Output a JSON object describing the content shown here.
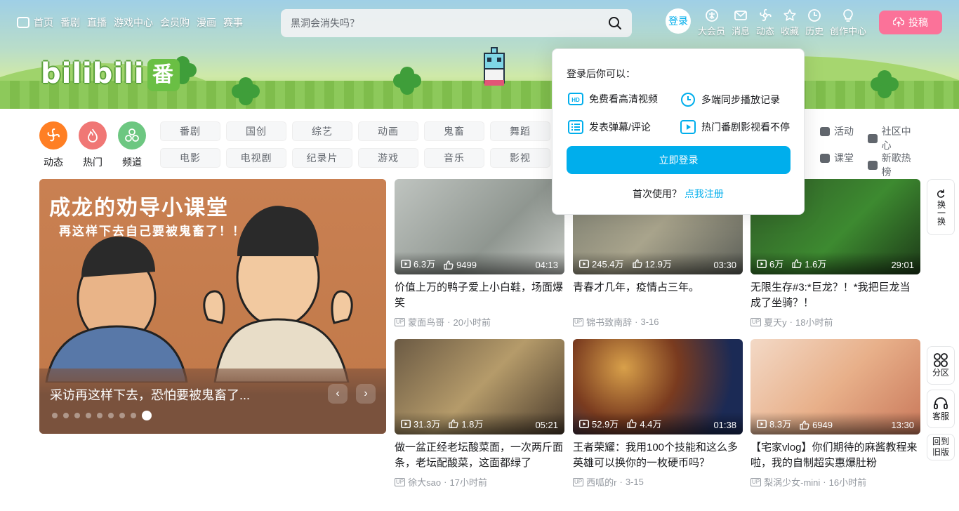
{
  "header": {
    "left_nav": [
      {
        "label": "首页",
        "icon": "tv-icon"
      },
      {
        "label": "番剧"
      },
      {
        "label": "直播"
      },
      {
        "label": "游戏中心"
      },
      {
        "label": "会员购"
      },
      {
        "label": "漫画"
      },
      {
        "label": "赛事"
      }
    ],
    "search": {
      "placeholder": "黑洞会消失吗？"
    },
    "login_label": "登录",
    "right_nav": [
      {
        "label": "大会员",
        "icon": "vip-icon"
      },
      {
        "label": "消息",
        "icon": "message-icon"
      },
      {
        "label": "动态",
        "icon": "dynamic-icon"
      },
      {
        "label": "收藏",
        "icon": "star-icon"
      },
      {
        "label": "历史",
        "icon": "clock-icon"
      },
      {
        "label": "创作中心",
        "icon": "bulb-icon"
      }
    ],
    "upload_label": "投稿"
  },
  "banner": {
    "logo_text": "bilibili",
    "logo_badge": "番"
  },
  "channels": {
    "icons": [
      {
        "label": "动态",
        "color": "#ff7f24"
      },
      {
        "label": "热门",
        "color": "#f07775"
      },
      {
        "label": "频道",
        "color": "#6dc781"
      }
    ],
    "tags": [
      "番剧",
      "国创",
      "综艺",
      "动画",
      "鬼畜",
      "舞蹈",
      "电影",
      "电视剧",
      "纪录片",
      "游戏",
      "音乐",
      "影视"
    ],
    "extras": [
      "活动",
      "社区中心",
      "课堂",
      "新歌热榜"
    ]
  },
  "carousel": {
    "art_title": "成龙的劝导小课堂",
    "art_subtitle": "再这样下去自己要被鬼畜了！！",
    "caption": "采访再这样下去，恐怕要被鬼畜了...",
    "dot_count": 9,
    "active_dot": 8
  },
  "videos": [
    {
      "views": "6.3万",
      "likes": "9499",
      "duration": "04:13",
      "title": "价值上万的鸭子爱上小白鞋，场面爆笑",
      "author": "蒙面鸟哥",
      "date": "20小时前"
    },
    {
      "views": "245.4万",
      "likes": "12.9万",
      "duration": "03:30",
      "title": "青春才几年，疫情占三年。",
      "author": "锦书致南辞",
      "date": "3-16"
    },
    {
      "views": "6万",
      "likes": "1.6万",
      "duration": "29:01",
      "title": "无限生存#3:*巨龙？！*我把巨龙当成了坐骑？！",
      "author": "夏天y",
      "date": "18小时前"
    },
    {
      "views": "31.3万",
      "likes": "1.8万",
      "duration": "05:21",
      "title": "做一盆正经老坛酸菜面，一次两斤面条，老坛配酸菜，这面都绿了",
      "author": "徐大sao",
      "date": "17小时前"
    },
    {
      "views": "52.9万",
      "likes": "4.4万",
      "duration": "01:38",
      "title": "王者荣耀：我用100个技能和这么多英雄可以换你的一枚硬币吗？",
      "author": "西呱的r",
      "date": "3-15"
    },
    {
      "views": "8.3万",
      "likes": "6949",
      "duration": "13:30",
      "title": "【宅家vlog】你们期待的麻酱教程来啦，我的自制超实惠爆肚粉",
      "author": "梨涡少女-mini",
      "date": "16小时前"
    }
  ],
  "login_popup": {
    "heading": "登录后你可以：",
    "perks": [
      {
        "label": "免费看高清视频",
        "icon": "hd-icon"
      },
      {
        "label": "多端同步播放记录",
        "icon": "sync-clock-icon"
      },
      {
        "label": "发表弹幕/评论",
        "icon": "danmaku-icon"
      },
      {
        "label": "热门番剧影视看不停",
        "icon": "play-icon"
      }
    ],
    "button": "立即登录",
    "register_prompt": "首次使用？",
    "register_link": "点我注册"
  },
  "side_buttons": {
    "refresh": "换一换",
    "category": "分区",
    "service": "客服",
    "old_version": "回到旧版"
  },
  "colors": {
    "accent": "#00aeec",
    "pink": "#fb7299"
  }
}
